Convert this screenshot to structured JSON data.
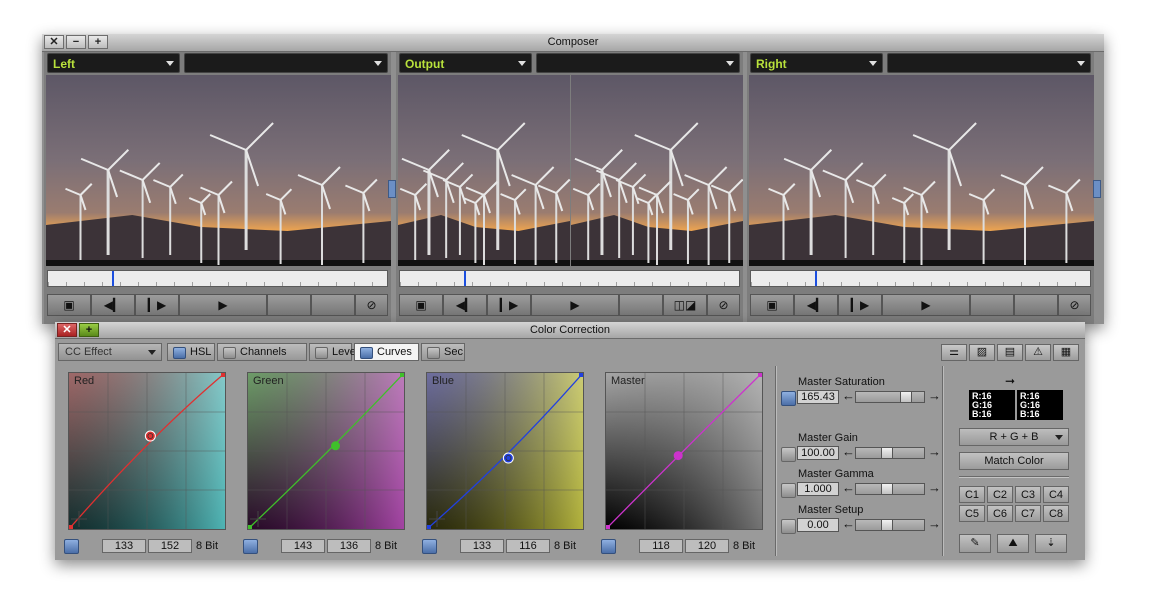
{
  "composer": {
    "title": "Composer",
    "controls": {
      "close": "✕",
      "minimize": "−",
      "plus": "+"
    },
    "monitors": [
      {
        "id": "left",
        "label": "Left",
        "second_label": "",
        "position_fraction": 0.19
      },
      {
        "id": "output",
        "label": "Output",
        "second_label": "",
        "position_fraction": 0.19
      },
      {
        "id": "right",
        "label": "Right",
        "second_label": "",
        "position_fraction": 0.19
      }
    ]
  },
  "color_correction": {
    "title": "Color Correction",
    "controls": {
      "close": "✕",
      "plus": "+"
    },
    "effect_dropdown": "CC Effect",
    "tabs": [
      {
        "label": "HSL",
        "active": false
      },
      {
        "label": "Channels",
        "active": false
      },
      {
        "label": "Levels",
        "active": false
      },
      {
        "label": "Curves",
        "active": true
      },
      {
        "label": "Sec",
        "active": false
      }
    ],
    "curves": [
      {
        "name": "Red",
        "in": "133",
        "out": "152",
        "bits": "8 Bit",
        "color": "#e03030",
        "bg_top": "#f4a0a0",
        "bg_bottom": "#1b4646",
        "accent": "#5fd8d8",
        "point": [
          133,
          152
        ],
        "ring": true
      },
      {
        "name": "Green",
        "in": "143",
        "out": "136",
        "bits": "8 Bit",
        "color": "#3fbf2a",
        "bg_top": "#a8f0a0",
        "bg_bottom": "#3d0f3d",
        "accent": "#c455c4",
        "point": [
          143,
          136
        ],
        "ring": false
      },
      {
        "name": "Blue",
        "in": "133",
        "out": "116",
        "bits": "8 Bit",
        "color": "#2140e0",
        "bg_top": "#a8a8f4",
        "bg_bottom": "#3d3d10",
        "accent": "#d8d84a",
        "point": [
          133,
          116
        ],
        "ring": true
      },
      {
        "name": "Master",
        "in": "118",
        "out": "120",
        "bits": "8 Bit",
        "color": "#cc33cc",
        "bg_top": "#ffffff",
        "bg_bottom": "#000000",
        "accent": "#9a9a9a",
        "point": [
          118,
          120
        ],
        "ring": false
      }
    ],
    "masters": [
      {
        "label": "Master Saturation",
        "value": "165.43",
        "level": 0.78,
        "enabled": true
      },
      {
        "label": "Master Gain",
        "value": "100.00",
        "level": 0.45,
        "enabled": false
      },
      {
        "label": "Master Gamma",
        "value": "1.000",
        "level": 0.45,
        "enabled": false
      },
      {
        "label": "Master Setup",
        "value": "0.00",
        "level": 0.45,
        "enabled": false
      }
    ],
    "match": {
      "source_swatch": [
        "R:16",
        "G:16",
        "B:16"
      ],
      "target_swatch": [
        "R:16",
        "G:16",
        "B:16"
      ],
      "mode": "R + G + B",
      "match_button": "Match Color",
      "cells": [
        "C1",
        "C2",
        "C3",
        "C4",
        "C5",
        "C6",
        "C7",
        "C8"
      ]
    }
  }
}
